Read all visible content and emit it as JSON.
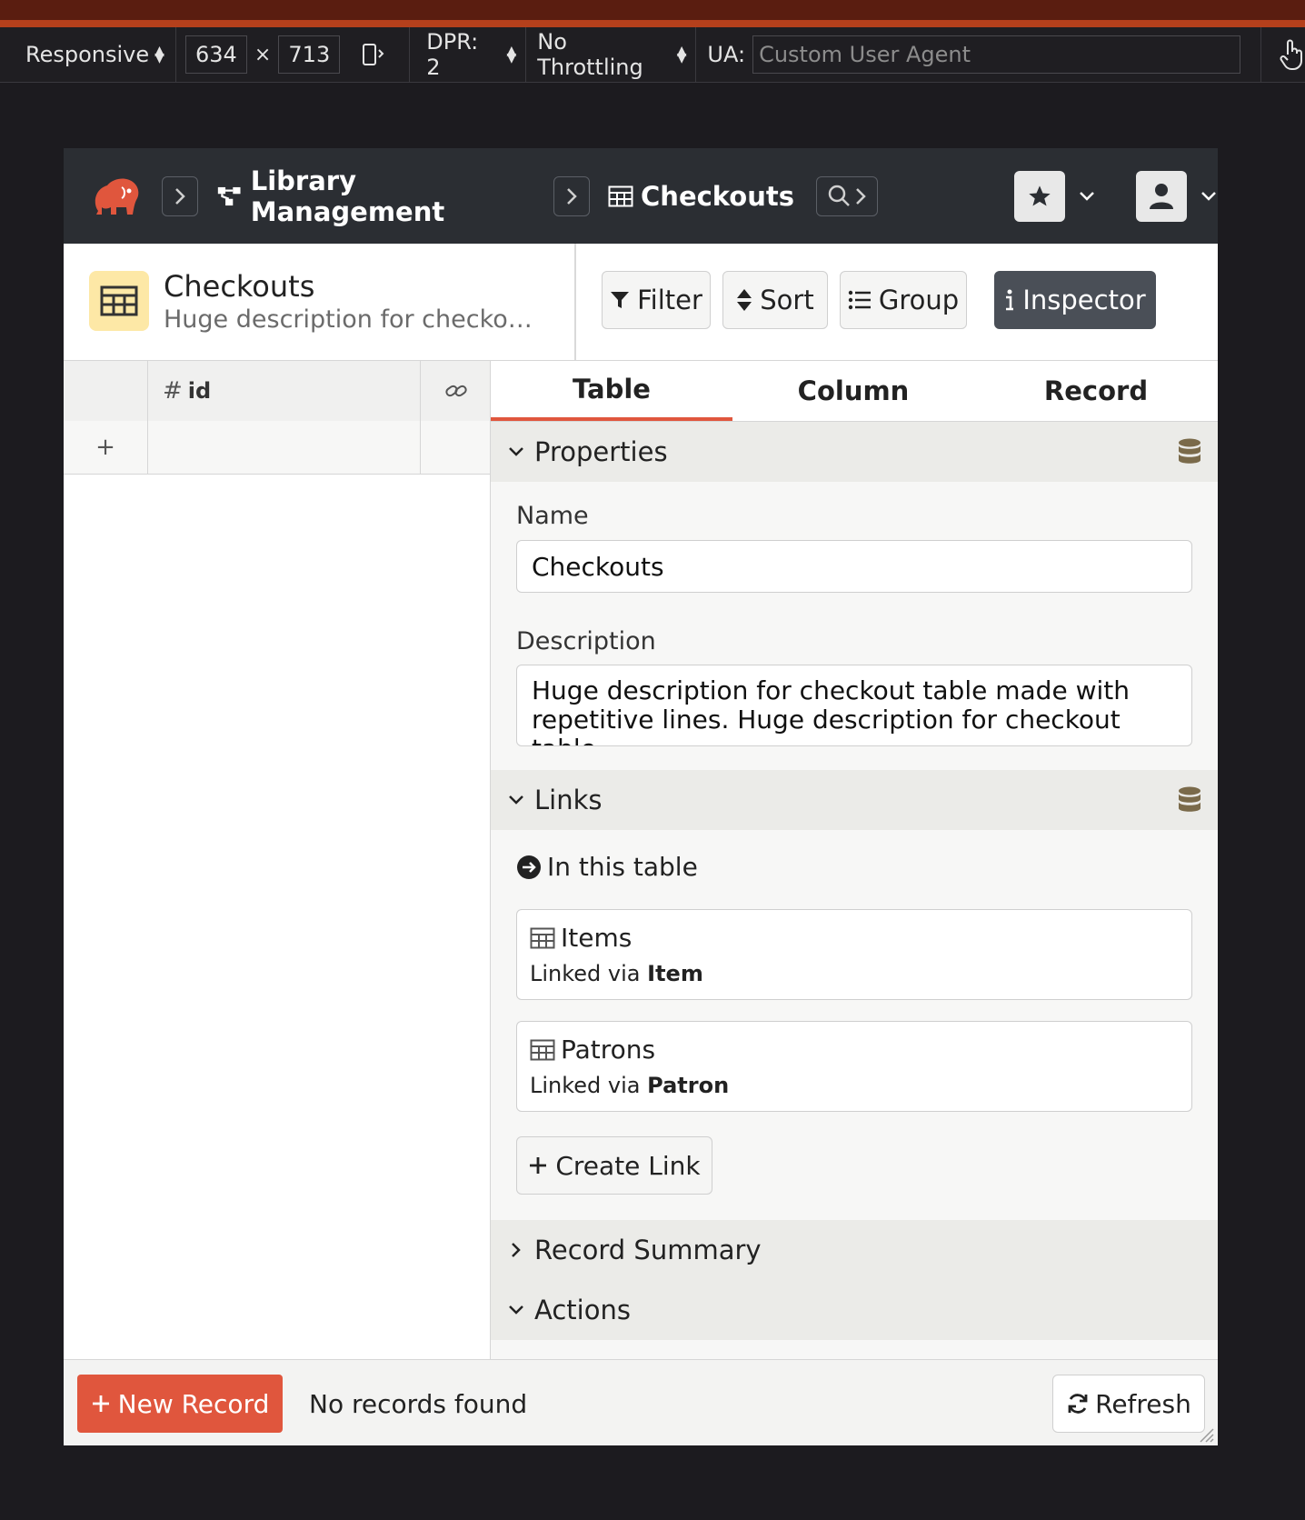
{
  "devtools": {
    "device_label": "Responsive",
    "width": "634",
    "times": "×",
    "height": "713",
    "dpr_label": "DPR: 2",
    "throttle_label": "No Throttling",
    "ua_label": "UA:",
    "ua_placeholder": "Custom User Agent"
  },
  "header": {
    "schema_title": "Library Management",
    "table_title": "Checkouts"
  },
  "table_info": {
    "name": "Checkouts",
    "description": "Huge description for checkout t..."
  },
  "toolbar": {
    "filter_label": "Filter",
    "sort_label": "Sort",
    "group_label": "Group",
    "inspector_label": "Inspector"
  },
  "grid": {
    "id_column": "id",
    "add_row": "+"
  },
  "inspector": {
    "tabs": [
      "Table",
      "Column",
      "Record"
    ],
    "properties": {
      "title": "Properties",
      "name_label": "Name",
      "name_value": "Checkouts",
      "description_label": "Description",
      "description_line1": "Huge description for checkout table made with",
      "description_line2": "repetitive lines. Huge description for checkout table"
    },
    "links": {
      "title": "Links",
      "in_this_table": "In this table",
      "items": [
        {
          "table": "Items",
          "via_prefix": "Linked via",
          "via": "Item"
        },
        {
          "table": "Patrons",
          "via_prefix": "Linked via",
          "via": "Patron"
        }
      ],
      "create_link": "Create Link"
    },
    "record_summary": "Record Summary",
    "actions": "Actions"
  },
  "footer": {
    "new_record": "New Record",
    "status": "No records found",
    "refresh": "Refresh"
  },
  "colors": {
    "accent": "#e0563d",
    "header_bg": "#2b2e33",
    "table_icon_bg": "#fde8a6"
  }
}
